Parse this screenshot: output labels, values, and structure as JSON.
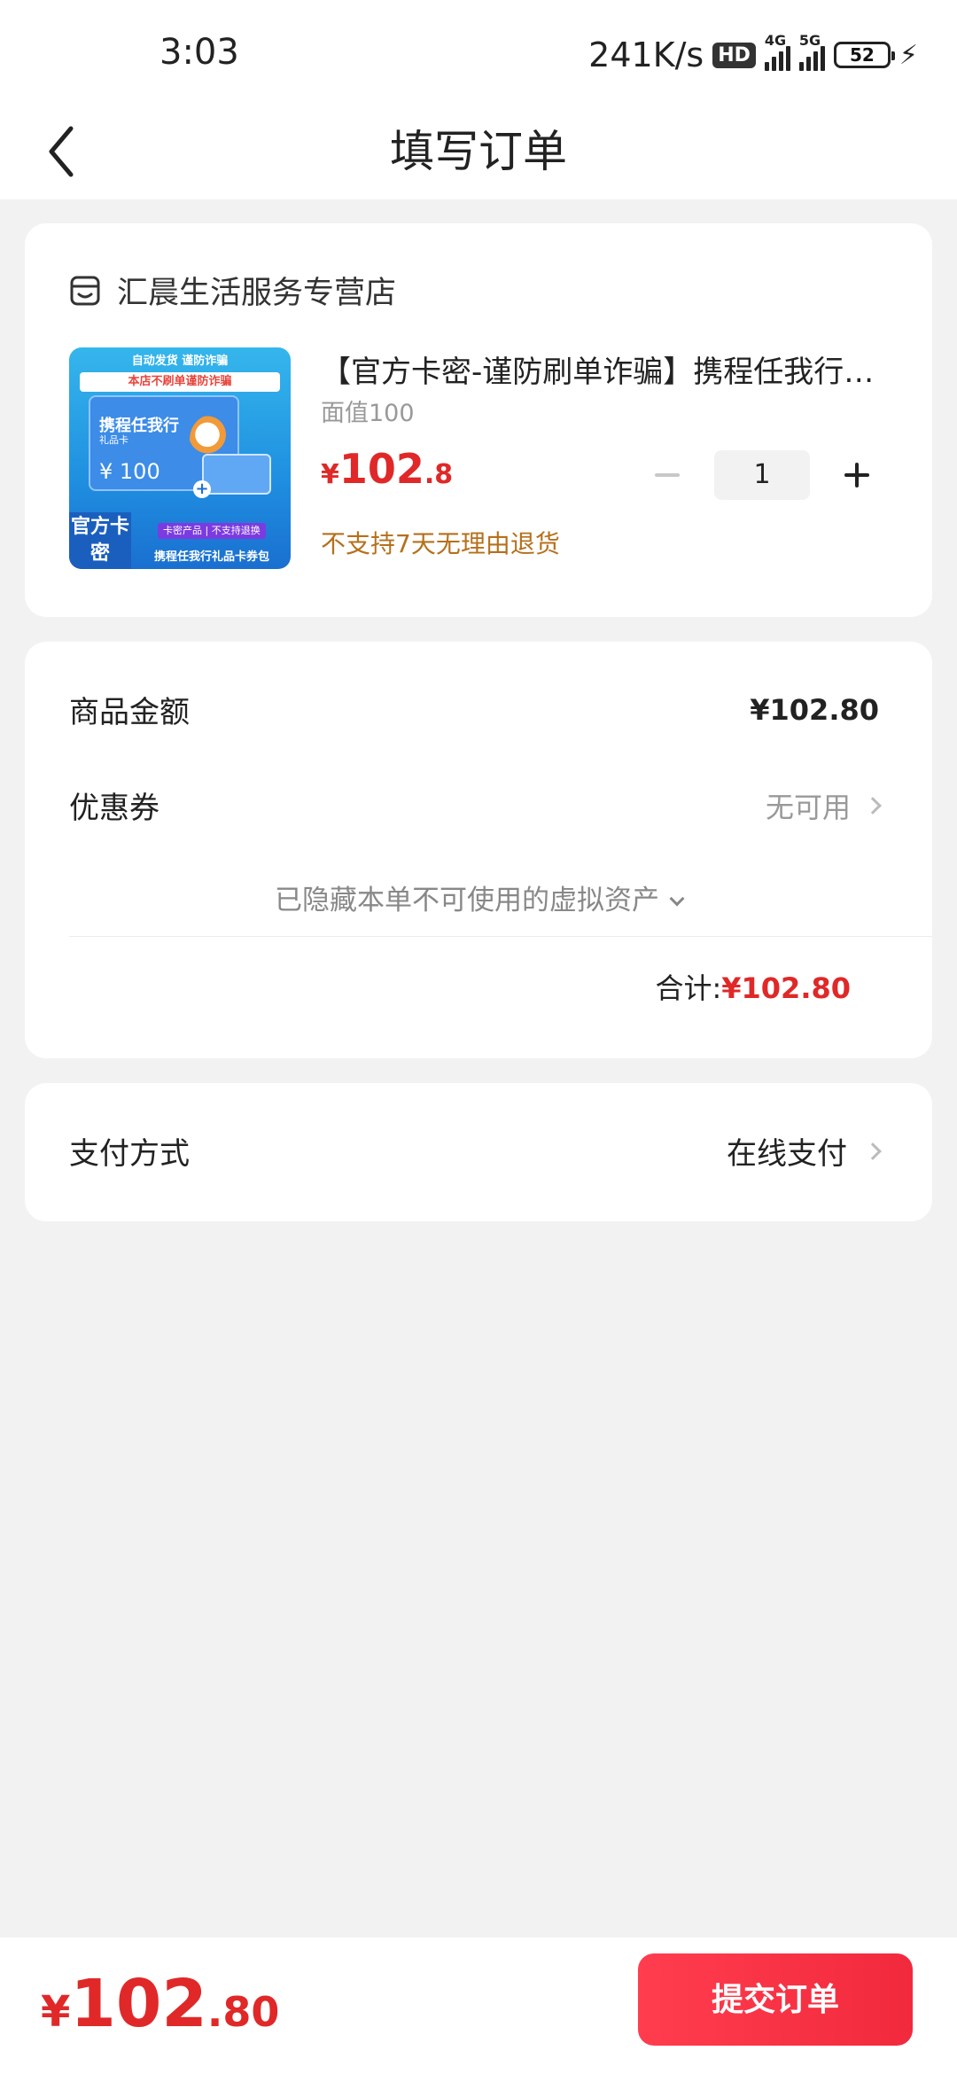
{
  "status_bar": {
    "time": "3:03",
    "speed": "241K/s",
    "hd": "HD",
    "net1": "4G",
    "net2": "5G",
    "battery": "52"
  },
  "header": {
    "title": "填写订单"
  },
  "store": {
    "name": "汇晨生活服务专营店"
  },
  "product": {
    "title": "【官方卡密-谨防刷单诈骗】携程任我行礼品卡",
    "spec": "面值100",
    "price_symbol": "¥",
    "price_int": "102",
    "price_dec": ".8",
    "quantity": "1",
    "notice": "不支持7天无理由退货",
    "image": {
      "top_text": "自动发货  谨防诈骗",
      "warn_text": "本店不刷单谨防诈骗",
      "card_title": "携程任我行",
      "card_sub": "礼品卡",
      "card_value": "¥ 100",
      "official": "官方卡密",
      "tag": "卡密产品 | 不支持退换",
      "bottom": "携程任我行礼品卡券包"
    }
  },
  "summary": {
    "goods_label": "商品金额",
    "goods_value": "¥102.80",
    "coupon_label": "优惠券",
    "coupon_value": "无可用",
    "hidden_note": "已隐藏本单不可使用的虚拟资产",
    "total_label": "合计:",
    "total_value": "¥102.80"
  },
  "payment": {
    "label": "支付方式",
    "value": "在线支付"
  },
  "bottom_bar": {
    "price_symbol": "¥",
    "price_int": "102",
    "price_dec": ".80",
    "submit_label": "提交订单"
  },
  "colors": {
    "accent": "#e02828",
    "notice": "#b5701c",
    "button": "#f2293d"
  }
}
